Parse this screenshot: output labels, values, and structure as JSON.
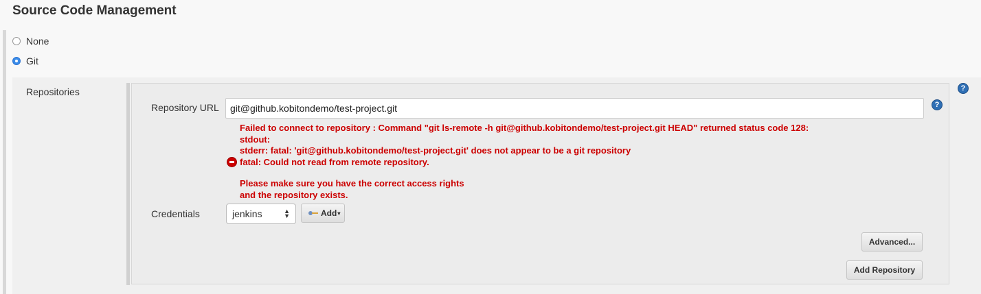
{
  "section": {
    "title": "Source Code Management"
  },
  "scm_options": [
    {
      "label": "None",
      "selected": false
    },
    {
      "label": "Git",
      "selected": true
    }
  ],
  "repositories": {
    "label": "Repositories",
    "url_label": "Repository URL",
    "url_value": "git@github.kobitondemo/test-project.git",
    "error_lines": [
      "Failed to connect to repository : Command \"git ls-remote -h git@github.kobitondemo/test-project.git HEAD\" returned status code 128:",
      "stdout:",
      "stderr: fatal: 'git@github.kobitondemo/test-project.git' does not appear to be a git repository",
      "fatal: Could not read from remote repository.",
      "Please make sure you have the correct access rights",
      "and the repository exists."
    ],
    "credentials_label": "Credentials",
    "credentials_value": "jenkins",
    "add_label": "Add",
    "advanced_label": "Advanced...",
    "add_repository_label": "Add Repository"
  },
  "help": {
    "symbol": "?"
  },
  "colors": {
    "error": "#cc0000",
    "accent": "#2f6fb5"
  }
}
